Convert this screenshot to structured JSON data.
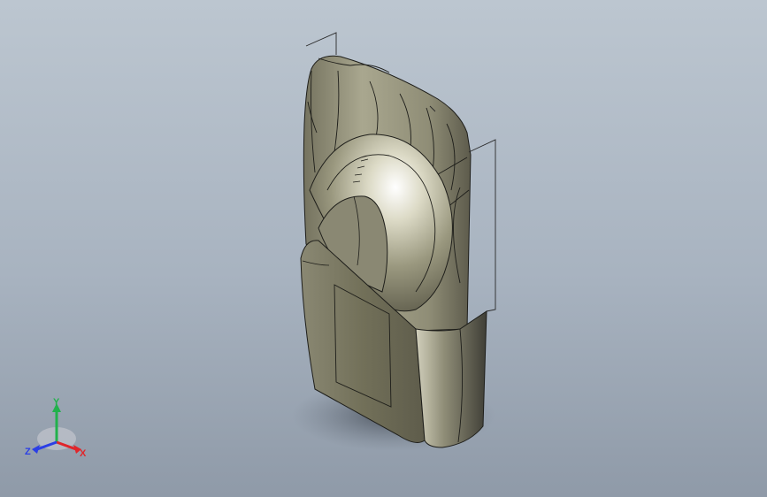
{
  "viewport": {
    "background_top": "#bcc6d0",
    "background_bottom": "#8f9aa8",
    "part_color": "#9c9a82"
  },
  "triad": {
    "x_label": "X",
    "y_label": "Y",
    "z_label": "Z",
    "x_color": "#e0262b",
    "y_color": "#22b14c",
    "z_color": "#2b3fe6"
  }
}
